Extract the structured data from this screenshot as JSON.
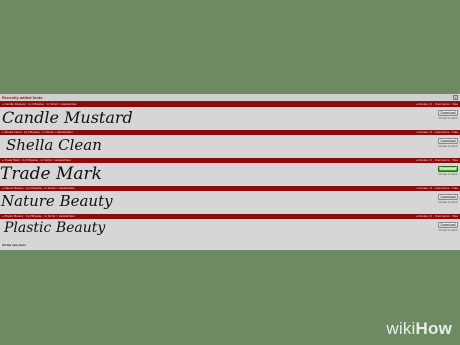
{
  "panel": {
    "title": "Recently added fonts",
    "close_icon": "x"
  },
  "rows": [
    {
      "meta": "» Candle Mustard · by Fiftywise · in Script > Handwritten",
      "right": "» Donate | ≡ · Comments · Vote",
      "preview": "Candle Mustard",
      "info": "",
      "download": "Download",
      "donate": "Donate to author",
      "active": false
    },
    {
      "meta": "» Shella Clean · by Fiftywise · in Script > Handwritten",
      "right": "» Donate | ≡ · Comments · Vote",
      "preview": "Shella Clean",
      "info": "",
      "download": "Download",
      "donate": "Donate to author",
      "active": false
    },
    {
      "meta": "» Trade Mark · by Fiftywise · in Script > Handwritten",
      "right": "» Donate | ≡ · Comments · Vote",
      "preview": "Trade Mark",
      "info": "",
      "download": "Download",
      "donate": "Donate to author",
      "active": true
    },
    {
      "meta": "» Nature Beauty · by Fiftywise · in Script > Handwritten",
      "right": "» Donate | ≡ · Comments · Vote",
      "preview": "Nature Beauty",
      "info": "",
      "download": "Download",
      "donate": "Donate to author",
      "active": false
    },
    {
      "meta": "» Plastic Beauty · by Fiftywise · in Script > Handwritten",
      "right": "» Donate | ≡ · Comments · Vote",
      "preview": "Plastic Beauty",
      "info": "",
      "download": "Download",
      "donate": "Donate to author",
      "active": false
    }
  ],
  "footer": {
    "link": "All the new fonts"
  },
  "watermark": {
    "part1": "wiki",
    "part2": "How"
  }
}
